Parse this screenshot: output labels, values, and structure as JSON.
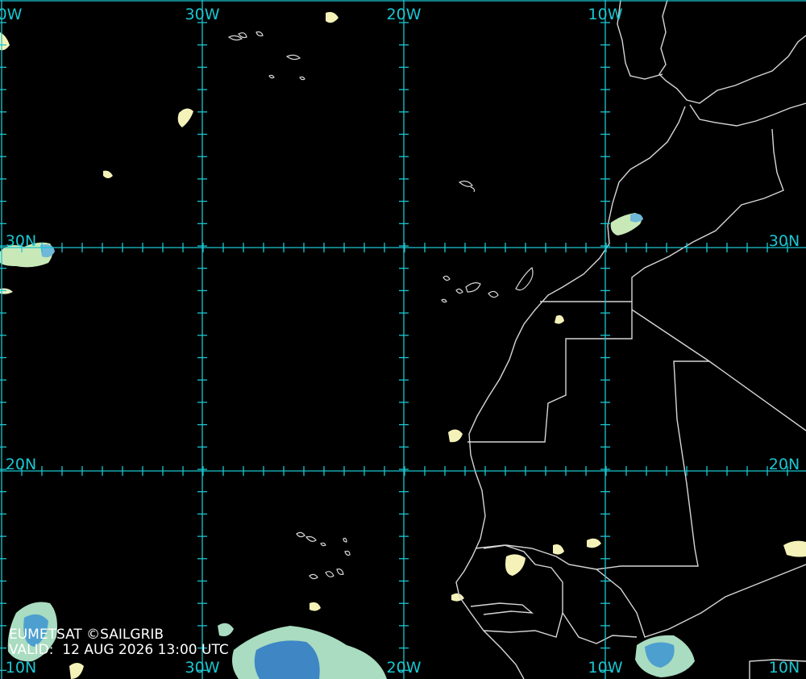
{
  "map": {
    "background": "#000000",
    "grid_color": "#19c7d2",
    "coast_color": "#d6d6d6",
    "cloud_colors": [
      "#f4f2b8",
      "#a9dcc0",
      "#5eb4d6",
      "#2f7fc6"
    ],
    "longitude_labels": [
      "0W",
      "30W",
      "20W",
      "10W"
    ],
    "latitude_labels": [
      "30N",
      "20N",
      "10N"
    ],
    "top_labels": [
      "0W",
      "30W",
      "20W",
      "10W"
    ],
    "bottom_labels": [
      "10N",
      "30W",
      "20W",
      "10W",
      "10N"
    ],
    "left_lat_labels": [
      "30N",
      "20N"
    ],
    "right_lat_labels": [
      "30N",
      "20N"
    ]
  },
  "credit": {
    "line1": "EUMETSAT ©SAILGRIB",
    "line2": "VALID:  12 AUG 2026 13:00 UTC"
  }
}
